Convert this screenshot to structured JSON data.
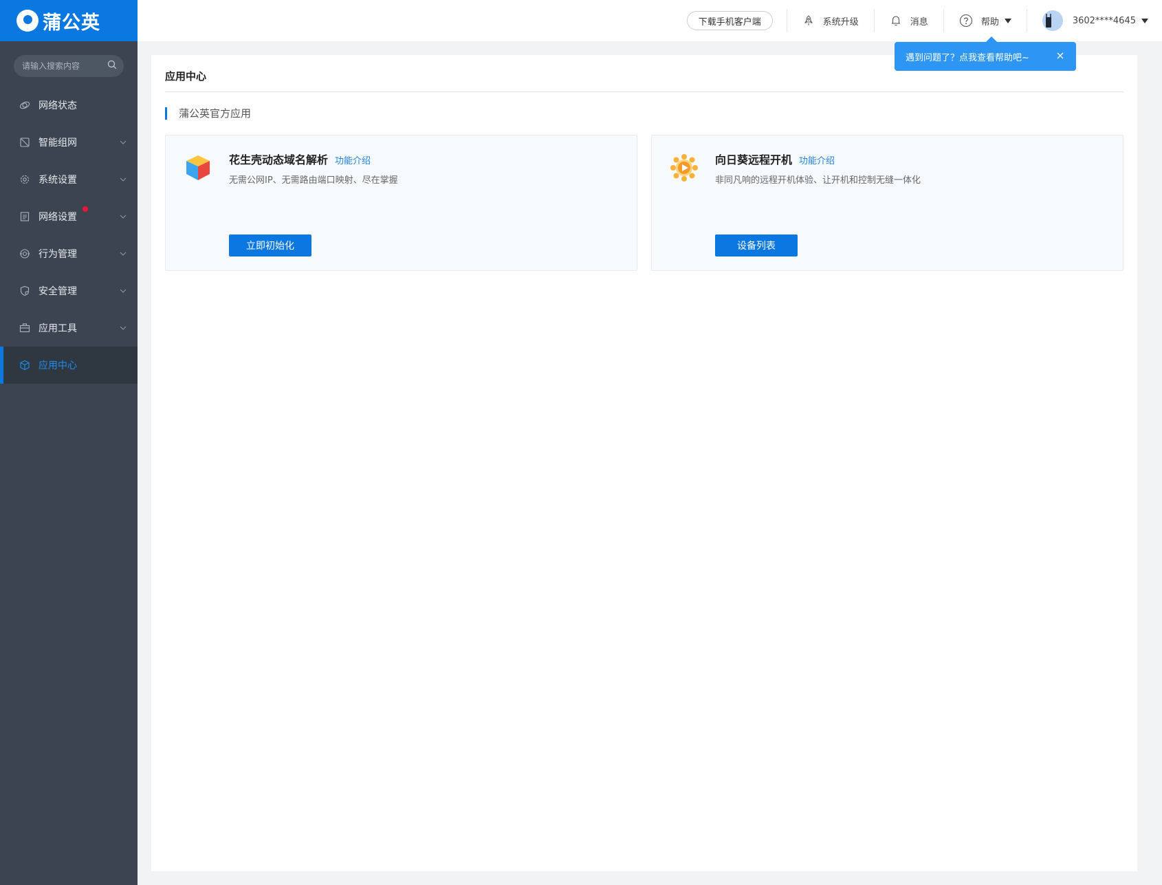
{
  "brand": {
    "name": "蒲公英",
    "color": "#0a78e0"
  },
  "sidebar": {
    "search_placeholder": "请输入搜索内容",
    "items": [
      {
        "label": "网络状态",
        "icon": "network-status-icon",
        "has_submenu": false,
        "active": false
      },
      {
        "label": "智能组网",
        "icon": "smart-network-icon",
        "has_submenu": true,
        "active": false
      },
      {
        "label": "系统设置",
        "icon": "gear-icon",
        "has_submenu": true,
        "active": false
      },
      {
        "label": "网络设置",
        "icon": "document-icon",
        "has_submenu": true,
        "active": false,
        "badge": "red-dot"
      },
      {
        "label": "行为管理",
        "icon": "behavior-icon",
        "has_submenu": true,
        "active": false
      },
      {
        "label": "安全管理",
        "icon": "shield-icon",
        "has_submenu": true,
        "active": false
      },
      {
        "label": "应用工具",
        "icon": "toolbox-icon",
        "has_submenu": true,
        "active": false
      },
      {
        "label": "应用中心",
        "icon": "cube-icon",
        "has_submenu": false,
        "active": true
      }
    ]
  },
  "header": {
    "download_label": "下载手机客户端",
    "upgrade_label": "系统升级",
    "messages_label": "消息",
    "help_label": "帮助",
    "account": "3602****4645"
  },
  "tooltip": {
    "text": "遇到问题了？点我查看帮助吧~"
  },
  "main": {
    "page_title": "应用中心",
    "section_title": "蒲公英官方应用",
    "cards": [
      {
        "title": "花生壳动态域名解析",
        "link": "功能介绍",
        "desc": "无需公网IP、无需路由端口映射、尽在掌握",
        "button": "立即初始化",
        "icon": "peanut-hull-cube-icon"
      },
      {
        "title": "向日葵远程开机",
        "link": "功能介绍",
        "desc": "非同凡响的远程开机体验、让开机和控制无缝一体化",
        "button": "设备列表",
        "icon": "sunflower-icon"
      }
    ]
  }
}
